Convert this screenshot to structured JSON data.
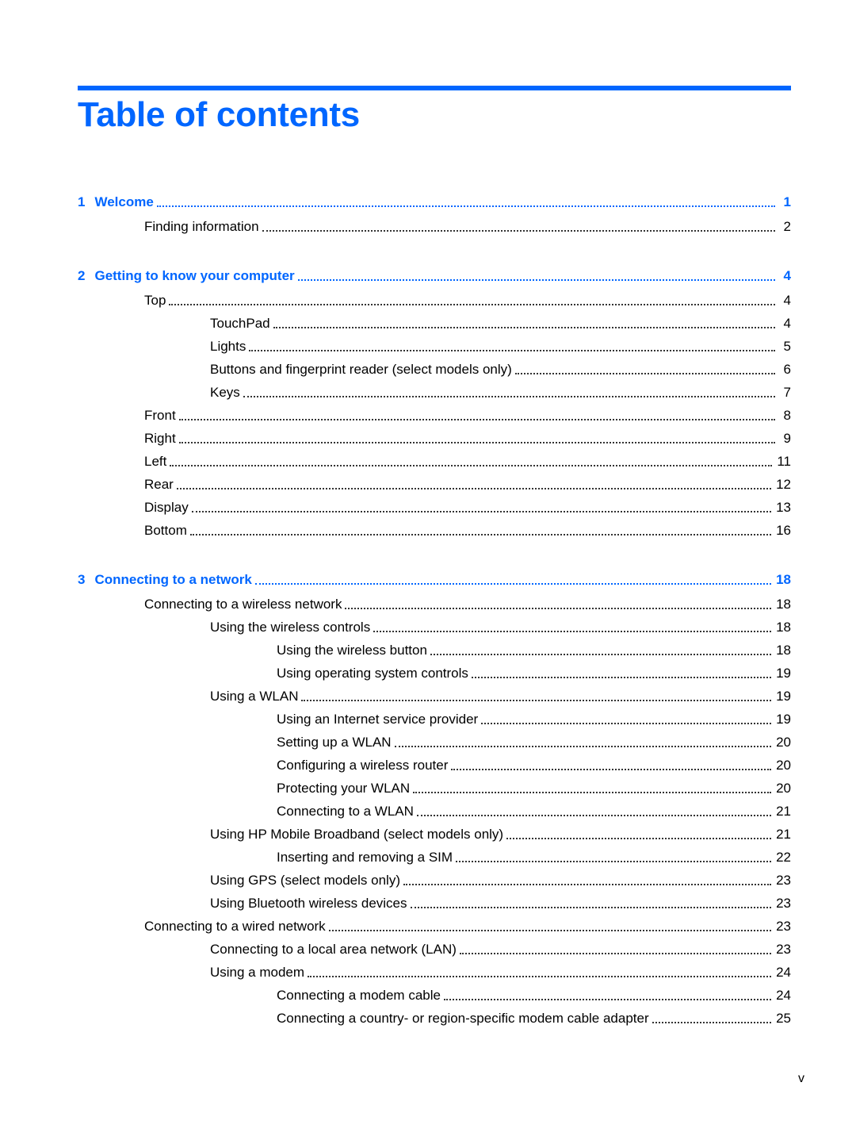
{
  "page": {
    "title": "Table of contents",
    "folio": "v",
    "accent_color": "#0066ff"
  },
  "toc": [
    {
      "level": 0,
      "num": "1",
      "label": "Welcome",
      "page": "1"
    },
    {
      "level": 1,
      "label": "Finding information",
      "page": "2"
    },
    {
      "level": 0,
      "num": "2",
      "label": "Getting to know your computer",
      "page": "4"
    },
    {
      "level": 1,
      "label": "Top",
      "page": "4"
    },
    {
      "level": 2,
      "label": "TouchPad",
      "page": "4"
    },
    {
      "level": 2,
      "label": "Lights",
      "page": "5"
    },
    {
      "level": 2,
      "label": "Buttons and fingerprint reader (select models only)",
      "page": "6"
    },
    {
      "level": 2,
      "label": "Keys",
      "page": "7"
    },
    {
      "level": 1,
      "label": "Front",
      "page": "8"
    },
    {
      "level": 1,
      "label": "Right",
      "page": "9"
    },
    {
      "level": 1,
      "label": "Left",
      "page": "11"
    },
    {
      "level": 1,
      "label": "Rear",
      "page": "12"
    },
    {
      "level": 1,
      "label": "Display",
      "page": "13"
    },
    {
      "level": 1,
      "label": "Bottom",
      "page": "16"
    },
    {
      "level": 0,
      "num": "3",
      "label": "Connecting to a network",
      "page": "18"
    },
    {
      "level": 1,
      "label": "Connecting to a wireless network",
      "page": "18"
    },
    {
      "level": 2,
      "label": "Using the wireless controls",
      "page": "18"
    },
    {
      "level": 3,
      "label": "Using the wireless button",
      "page": "18"
    },
    {
      "level": 3,
      "label": "Using operating system controls",
      "page": "19"
    },
    {
      "level": 2,
      "label": "Using a WLAN",
      "page": "19"
    },
    {
      "level": 3,
      "label": "Using an Internet service provider",
      "page": "19"
    },
    {
      "level": 3,
      "label": "Setting up a WLAN",
      "page": "20"
    },
    {
      "level": 3,
      "label": "Configuring a wireless router",
      "page": "20"
    },
    {
      "level": 3,
      "label": "Protecting your WLAN",
      "page": "20"
    },
    {
      "level": 3,
      "label": "Connecting to a WLAN",
      "page": "21"
    },
    {
      "level": 2,
      "label": "Using HP Mobile Broadband (select models only)",
      "page": "21"
    },
    {
      "level": 3,
      "label": "Inserting and removing a SIM",
      "page": "22"
    },
    {
      "level": 2,
      "label": "Using GPS (select models only)",
      "page": "23"
    },
    {
      "level": 2,
      "label": "Using Bluetooth wireless devices",
      "page": "23"
    },
    {
      "level": 1,
      "label": "Connecting to a wired network",
      "page": "23"
    },
    {
      "level": 2,
      "label": "Connecting to a local area network (LAN)",
      "page": "23"
    },
    {
      "level": 2,
      "label": "Using a modem",
      "page": "24"
    },
    {
      "level": 3,
      "label": "Connecting a modem cable",
      "page": "24"
    },
    {
      "level": 3,
      "label": "Connecting a country- or region-specific modem cable adapter",
      "page": "25"
    }
  ]
}
